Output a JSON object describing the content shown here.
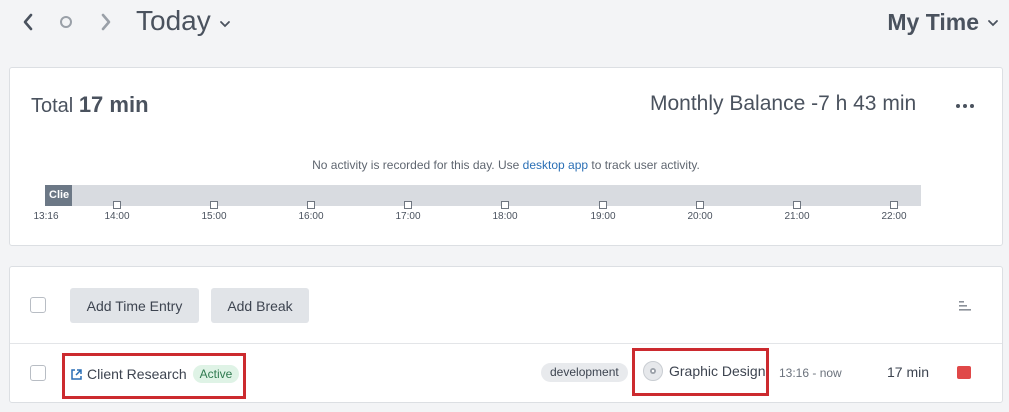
{
  "header": {
    "day_title": "Today",
    "view_title": "My Time"
  },
  "summary": {
    "total_prefix": "Total",
    "total_value": "17 min",
    "balance_label": "Monthly Balance",
    "balance_value": "-7 h 43 min",
    "no_activity_prefix": "No activity is recorded for this day. Use ",
    "no_activity_link": "desktop app",
    "no_activity_suffix": " to track user activity.",
    "timeline_block_label": "Clie",
    "ticks": [
      "13:16",
      "14:00",
      "15:00",
      "16:00",
      "17:00",
      "18:00",
      "19:00",
      "20:00",
      "21:00",
      "22:00"
    ]
  },
  "toolbar": {
    "add_time_entry": "Add Time Entry",
    "add_break": "Add Break"
  },
  "entry": {
    "title": "Client Research",
    "status": "Active",
    "tag": "development",
    "project": "Graphic Design",
    "time_range": "13:16 - now",
    "duration": "17 min"
  },
  "colors": {
    "accent_link": "#2a6fb5",
    "active_badge_bg": "#dff3e6",
    "stop_red": "#e04848",
    "highlight_red": "#cc2a2f"
  },
  "icons": {
    "prev": "chevron-left-icon",
    "today": "circle-icon",
    "next": "chevron-right-icon",
    "dropdown": "chevron-down-icon",
    "more": "more-horizontal-icon",
    "sort": "sort-icon",
    "open": "external-link-icon",
    "project": "project-avatar-icon",
    "stop": "stop-icon"
  }
}
